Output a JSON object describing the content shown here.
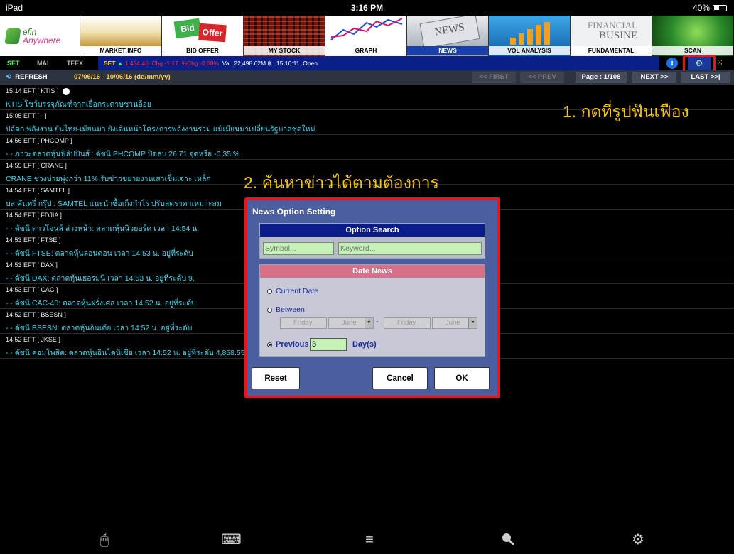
{
  "status": {
    "device": "iPad",
    "time": "3:16 PM",
    "battery": "40%"
  },
  "topmenu": {
    "logo_line1": "efin",
    "logo_line2": "Anywhere",
    "items": [
      {
        "label": "MARKET INFO",
        "icon": "coins-image"
      },
      {
        "label": "BID OFFER",
        "icon": "bid-offer-image"
      },
      {
        "label": "MY STOCK",
        "icon": "stock-board-image"
      },
      {
        "label": "GRAPH",
        "icon": "graph-image"
      },
      {
        "label": "NEWS",
        "icon": "newspaper-image"
      },
      {
        "label": "VOL ANALYSIS",
        "icon": "bar-chart-image"
      },
      {
        "label": "FUNDAMENTAL",
        "icon": "financial-paper-image"
      },
      {
        "label": "SCAN",
        "icon": "scan-image"
      }
    ],
    "active": "NEWS"
  },
  "indexbar": {
    "tabs": [
      "SET",
      "MAI",
      "TFEX"
    ],
    "market": "SET",
    "index_value": "1,434.46",
    "chg_label": "Chg",
    "chg_value": "-1.17",
    "pchg_label": "%Chg",
    "pchg_value": "-0.08%",
    "val_label": "Val.",
    "val_value": "22,498.62M ฿.",
    "time": "15:16:11",
    "state": "Open"
  },
  "toolbar": {
    "refresh": "REFRESH",
    "date_range": "07/06/16 - 10/06/16 (dd/mm/yy)",
    "first": "<< FIRST",
    "prev": "<< PREV",
    "page": "Page : 1/108",
    "next": "NEXT >>",
    "last": "LAST >>|"
  },
  "news": [
    {
      "header": "15:14  EFT [ KTIS ]",
      "headline": "KTIS โชว์บรรจุภัณฑ์จากเยื่อกระดาษชานอ้อย"
    },
    {
      "header": "15:05  EFT [ - ]",
      "headline": "ปลัดก.พลังงาน ยันไทย-เมียนมา ยังเดินหน้าโครงการพลังงานร่วม แม้เมียนมาเปลี่ยนรัฐบาลชุดใหม่"
    },
    {
      "header": "14:56  EFT [ PHCOMP ]",
      "headline": "- - ภาวะตลาดหุ้นฟิลิปปินส์ :  ดัชนี PHCOMP ปิดลบ  26.71 จุดหรือ -0.35 %"
    },
    {
      "header": "14:55  EFT [ CRANE ]",
      "headline": "CRANE ช่วงบ่ายพุ่งกว่า 11% รับข่าวขยายงานเสาเข็มเจาะ เหล็ก"
    },
    {
      "header": "14:54  EFT [ SAMTEL ]",
      "headline": "บล.คันทรี่ กรุ๊ป : SAMTEL แนะนำซื้อเก็งกำไร ปรับลดราคาเหมาะสม"
    },
    {
      "header": "14:54  EFT [ FDJIA ]",
      "headline": "- - ดัชนี ดาวโจนส์ ล่วงหน้า: ตลาดหุ้นนิวยอร์ค  เวลา 14:54  น."
    },
    {
      "header": "14:53  EFT [ FTSE ]",
      "headline": "- - ดัชนี FTSE: ตลาดหุ้นลอนดอน  เวลา 14:53  น.  อยู่ที่ระดับ"
    },
    {
      "header": "14:53  EFT [ DAX ]",
      "headline": "- - ดัชนี DAX: ตลาดหุ้นเยอรมนี  เวลา 14:53  น.  อยู่ที่ระดับ 9,"
    },
    {
      "header": "14:53  EFT [ CAC ]",
      "headline": "- - ดัชนี CAC-40: ตลาดหุ้นฝรั่งเศส  เวลา 14:52  น.  อยู่ที่ระดับ"
    },
    {
      "header": "14:52  EFT [ BSESN ]",
      "headline": "- - ดัชนี BSESN: ตลาดหุ้นอินเดีย  เวลา 14:52  น.  อยู่ที่ระดับ"
    },
    {
      "header": "14:52  EFT [ JKSE ]",
      "headline": "- - ดัชนี คอมโพสิต: ตลาดหุ้นอินโดนีเซีย  เวลา 14:52  น.  อยู่ที่ระดับ 4,858.55 จุด ลดลง 18.24 จุด หรือ -0.37 %"
    }
  ],
  "annotations": {
    "step1": "1. กดที่รูปฟันเฟือง",
    "step2": "2. ค้นหาข่าวได้ตามต้องการ"
  },
  "dialog": {
    "title": "News Option Setting",
    "option_search": "Option Search",
    "symbol_placeholder": "Symbol...",
    "keyword_placeholder": "Keyword...",
    "date_news": "Date News",
    "current_date": "Current Date",
    "between": "Between",
    "from_day": "Friday",
    "from_month": "June",
    "to_day": "Friday",
    "to_month": "June",
    "dash": "-",
    "previous": "Previous",
    "previous_days": "3",
    "days_label": "Day(s)",
    "reset": "Reset",
    "cancel": "Cancel",
    "ok": "OK",
    "selected_option": "Previous"
  },
  "tabbar": [
    "mouse-icon",
    "keyboard-icon",
    "list-icon",
    "search-icon",
    "gear-icon"
  ],
  "colors": {
    "accent_yellow": "#f2c510",
    "highlight_red": "#e0181f",
    "headline_cyan": "#3fd5ee",
    "index_blue": "#0b1f8a"
  }
}
